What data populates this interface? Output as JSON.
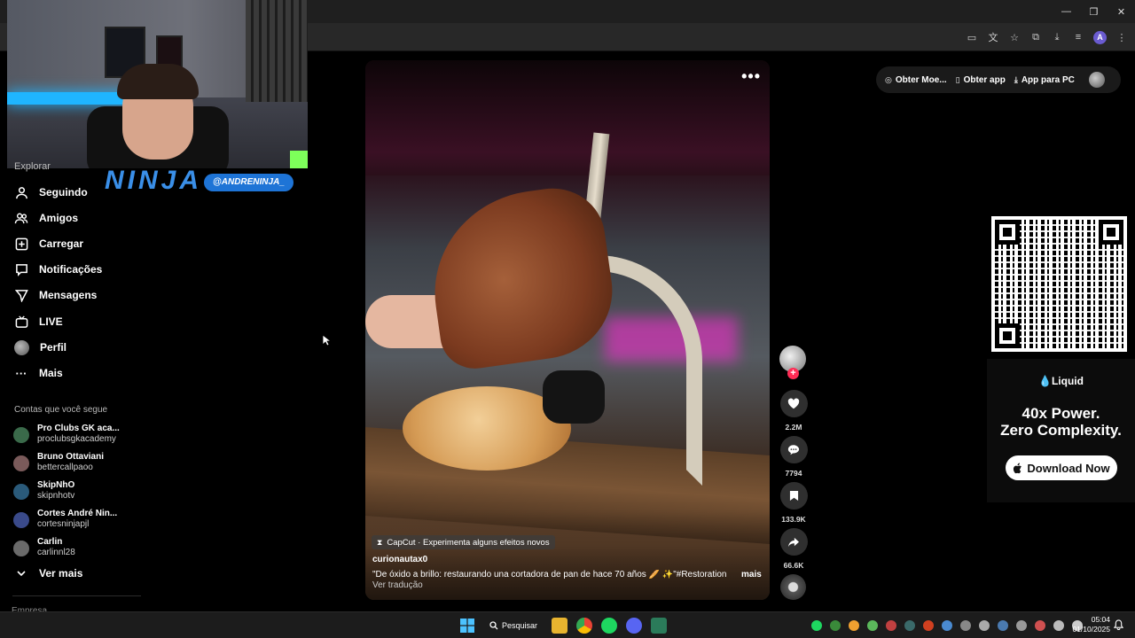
{
  "browser": {
    "window_controls": {
      "minimize": "—",
      "maximize": "❐",
      "close": "✕"
    },
    "toolbar_icons": [
      "cast-icon",
      "translate-icon",
      "star-icon",
      "extensions-icon",
      "download-icon",
      "media-icon",
      "profile-icon",
      "menu-icon"
    ],
    "profile_initial": "A"
  },
  "stream_overlay": {
    "title": "NINJA",
    "handle": "@ANDRENINJA_"
  },
  "sidebar": {
    "partial_item": "Explorar",
    "items": [
      {
        "label": "Seguindo",
        "icon": "person-icon"
      },
      {
        "label": "Amigos",
        "icon": "people-icon"
      },
      {
        "label": "Carregar",
        "icon": "plus-box-icon"
      },
      {
        "label": "Notificações",
        "icon": "notification-icon"
      },
      {
        "label": "Mensagens",
        "icon": "send-icon"
      },
      {
        "label": "LIVE",
        "icon": "live-tv-icon"
      },
      {
        "label": "Perfil",
        "icon": "avatar"
      },
      {
        "label": "Mais",
        "icon": "more-dots-icon"
      }
    ],
    "following_label": "Contas que você segue",
    "accounts": [
      {
        "name": "Pro Clubs GK aca...",
        "handle": "proclubsgkacademy",
        "color": "#3a6a4a"
      },
      {
        "name": "Bruno Ottaviani",
        "handle": "bettercallpaoo",
        "color": "#7a5a5a"
      },
      {
        "name": "SkipNhO",
        "handle": "skipnhotv",
        "color": "#2a5a7a"
      },
      {
        "name": "Cortes André Nin...",
        "handle": "cortesninjapjl",
        "color": "#3a4a8a"
      },
      {
        "name": "Carlin",
        "handle": "carlinnl28",
        "color": "#6a6a6a"
      }
    ],
    "see_more": "Ver mais",
    "partial_bottom": "Empresa"
  },
  "video": {
    "more": "•••",
    "effect_tag": "CapCut · Experimenta alguns efeitos novos",
    "author": "curionautax0",
    "caption": "\"De óxido a brillo: restaurando una cortadora de pan de hace 70 años 🥖 ✨\"#Restoration ...",
    "caption_more": "mais",
    "translate": "Ver tradução"
  },
  "actions": {
    "follow": "+",
    "likes": "2.2M",
    "comments": "7794",
    "saves": "133.9K",
    "shares": "66.6K"
  },
  "top_right": {
    "coins": "Obter Moe...",
    "get_app": "Obter app",
    "pc_app": "App para PC"
  },
  "ad": {
    "brand": "💧Liquid",
    "headline_1": "40x Power.",
    "headline_2": "Zero Complexity.",
    "button": "Download Now"
  },
  "taskbar": {
    "search": "Pesquisar",
    "time": "05:04",
    "date": "01/10/2025"
  }
}
